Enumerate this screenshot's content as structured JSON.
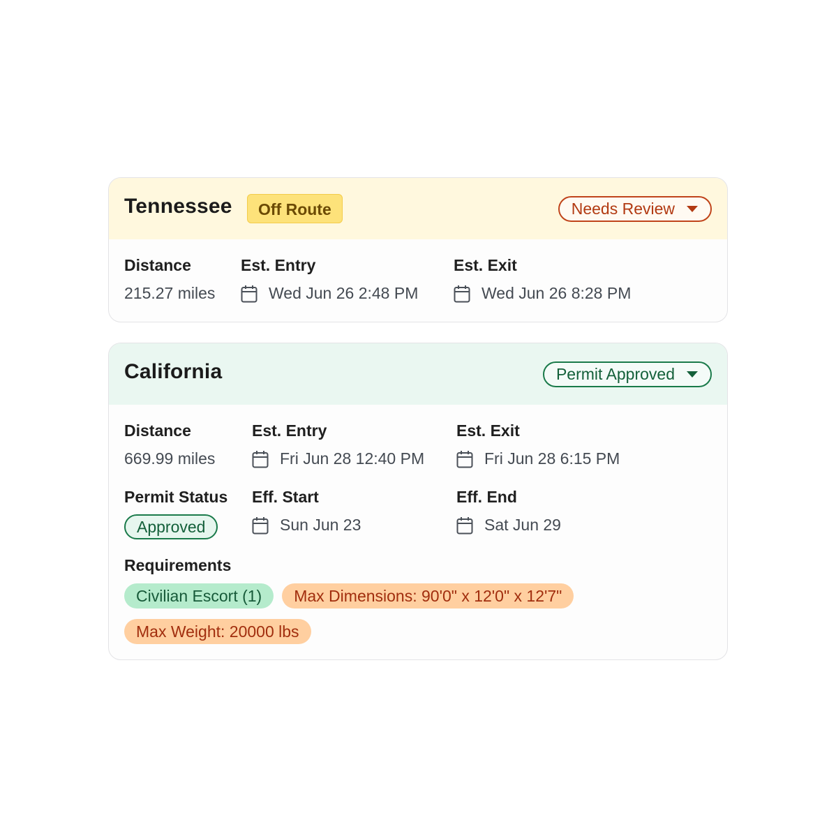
{
  "states": {
    "tennessee": {
      "name": "Tennessee",
      "badge": "Off Route",
      "status": "Needs Review",
      "distance_label": "Distance",
      "distance_value": "215.27 miles",
      "entry_label": "Est. Entry",
      "entry_value": "Wed Jun 26 2:48 PM",
      "exit_label": "Est. Exit",
      "exit_value": "Wed Jun 26 8:28 PM"
    },
    "california": {
      "name": "California",
      "status": "Permit Approved",
      "distance_label": "Distance",
      "distance_value": "669.99 miles",
      "entry_label": "Est. Entry",
      "entry_value": "Fri Jun 28 12:40 PM",
      "exit_label": "Est. Exit",
      "exit_value": "Fri Jun 28 6:15 PM",
      "permit_status_label": "Permit Status",
      "permit_status_value": "Approved",
      "eff_start_label": "Eff. Start",
      "eff_start_value": "Sun Jun 23",
      "eff_end_label": "Eff. End",
      "eff_end_value": "Sat Jun 29",
      "requirements_label": "Requirements",
      "requirements": [
        "Civilian Escort (1)",
        "Max Dimensions: 90'0\" x 12'0\" x 12'7\"",
        "Max Weight: 20000 lbs"
      ]
    }
  },
  "colors": {
    "tn_header_bg": "#fff8de",
    "ca_header_bg": "#eaf7f1",
    "needs_review": "#b23a12",
    "approved": "#14603a",
    "off_route_bg": "#fde27a",
    "tag_green_bg": "#b5ebcc",
    "tag_orange_bg": "#ffcfa0"
  },
  "icons": [
    "calendar-icon",
    "caret-down-icon"
  ]
}
